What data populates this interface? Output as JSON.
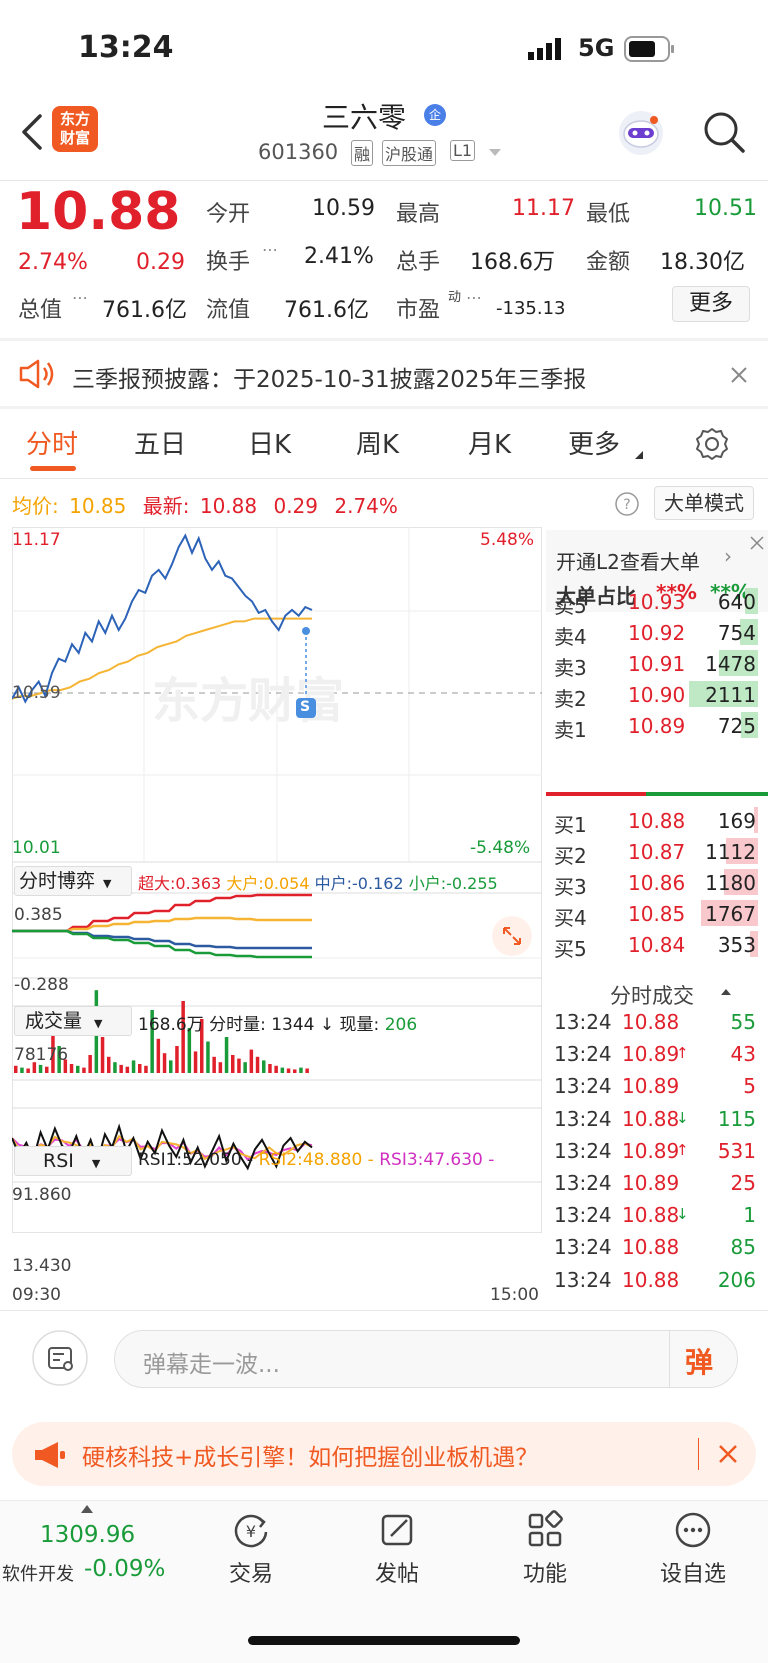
{
  "status": {
    "time": "13:24",
    "network": "5G"
  },
  "header": {
    "title": "三六零",
    "title_badge": "企",
    "code": "601360",
    "tags": [
      "融",
      "沪股通",
      "L1"
    ],
    "logo_text_1": "东方",
    "logo_text_2": "财富"
  },
  "quote": {
    "price": "10.88",
    "change_pct": "2.74%",
    "change": "0.29",
    "open_label": "今开",
    "open": "10.59",
    "high_label": "最高",
    "high": "11.17",
    "low_label": "最低",
    "low": "10.51",
    "turnover_label": "换手",
    "turnover": "2.41%",
    "volume_label": "总手",
    "volume": "168.6万",
    "amount_label": "金额",
    "amount": "18.30亿",
    "mktcap_label": "总值",
    "mktcap": "761.6亿",
    "float_label": "流值",
    "float": "761.6亿",
    "pe_label": "市盈",
    "pe_sup": "动",
    "pe": "-135.13",
    "more_button": "更多"
  },
  "notice": {
    "text": "三季报预披露：于2025-10-31披露2025年三季报"
  },
  "tabs": [
    "分时",
    "五日",
    "日K",
    "周K",
    "月K",
    "更多"
  ],
  "chart_info": {
    "avg_label": "均价:",
    "avg": "10.85",
    "latest_label": "最新:",
    "latest": "10.88",
    "chg": "0.29",
    "chg_pct": "2.74%",
    "mode_button": "大单模式"
  },
  "main_chart": {
    "top_left": "11.17",
    "top_right": "5.48%",
    "mid_left": "10.59",
    "bottom_left": "10.01",
    "bottom_right": "-5.48%",
    "time_start": "09:30",
    "time_end": "15:00",
    "marker": "S",
    "watermark": "东方财富"
  },
  "game_panel": {
    "label": "分时博弈",
    "super_label": "超大:",
    "super": "0.363",
    "large_label": "大户:",
    "large": "0.054",
    "mid_label": "中户:",
    "mid": "-0.162",
    "small_label": "小户:",
    "small": "-0.255",
    "top": "0.385",
    "bottom": "-0.288"
  },
  "volume_panel": {
    "label": "成交量",
    "total": "168.6万",
    "tick_label": "分时量:",
    "tick": "1344",
    "arrow": "↓",
    "now_label": "现量:",
    "now": "206",
    "max": "78176"
  },
  "rsi_panel": {
    "label": "RSI",
    "rsi1_label": "RSI1:",
    "rsi1": "52.050",
    "rsi2_label": "RSI2:",
    "rsi2": "48.880",
    "rsi3_label": "RSI3:",
    "rsi3": "47.630",
    "top": "91.860",
    "bottom": "13.430"
  },
  "l2": {
    "title": "开通L2查看大单",
    "ratio_label": "大单占比",
    "ratio_red": "**%",
    "ratio_green": "**%"
  },
  "asks": [
    {
      "label": "卖5",
      "price": "10.93",
      "vol": "640",
      "bar": 0.19
    },
    {
      "label": "卖4",
      "price": "10.92",
      "vol": "754",
      "bar": 0.25
    },
    {
      "label": "卖3",
      "price": "10.91",
      "vol": "1478",
      "bar": 0.55
    },
    {
      "label": "卖2",
      "price": "10.90",
      "vol": "2111",
      "bar": 0.99
    },
    {
      "label": "卖1",
      "price": "10.89",
      "vol": "725",
      "bar": 0.24
    }
  ],
  "bids": [
    {
      "label": "买1",
      "price": "10.88",
      "vol": "169",
      "bar": 0.06
    },
    {
      "label": "买2",
      "price": "10.87",
      "vol": "1112",
      "bar": 0.45
    },
    {
      "label": "买3",
      "price": "10.86",
      "vol": "1180",
      "bar": 0.48
    },
    {
      "label": "买4",
      "price": "10.85",
      "vol": "1767",
      "bar": 0.82
    },
    {
      "label": "买5",
      "price": "10.84",
      "vol": "353",
      "bar": 0.12
    }
  ],
  "trades_title": "分时成交",
  "trades": [
    {
      "time": "13:24",
      "price": "10.88",
      "arrow": "",
      "vol": "55",
      "dir": "g"
    },
    {
      "time": "13:24",
      "price": "10.89",
      "arrow": "↑",
      "vol": "43",
      "dir": "r"
    },
    {
      "time": "13:24",
      "price": "10.89",
      "arrow": "",
      "vol": "5",
      "dir": "r"
    },
    {
      "time": "13:24",
      "price": "10.88",
      "arrow": "↓",
      "vol": "115",
      "dir": "g"
    },
    {
      "time": "13:24",
      "price": "10.89",
      "arrow": "↑",
      "vol": "531",
      "dir": "r"
    },
    {
      "time": "13:24",
      "price": "10.89",
      "arrow": "",
      "vol": "25",
      "dir": "r"
    },
    {
      "time": "13:24",
      "price": "10.88",
      "arrow": "↓",
      "vol": "1",
      "dir": "g"
    },
    {
      "time": "13:24",
      "price": "10.88",
      "arrow": "",
      "vol": "85",
      "dir": "g"
    },
    {
      "time": "13:24",
      "price": "10.88",
      "arrow": "",
      "vol": "206",
      "dir": "g"
    }
  ],
  "danmaku": {
    "placeholder": "弹幕走一波...",
    "button": "弹"
  },
  "ad": {
    "text": "硬核科技+成长引擎！如何把握创业板机遇？"
  },
  "bottom": {
    "index_value": "1309.96",
    "index_name": "软件开发",
    "index_chg": "-0.09%",
    "items": [
      "交易",
      "发帖",
      "功能",
      "设自选"
    ]
  },
  "colors": {
    "red": "#e0202b",
    "green": "#1a9b3a",
    "orange": "#f56a1e",
    "blue": "#2c63b8",
    "avg_yellow": "#f5b433"
  }
}
